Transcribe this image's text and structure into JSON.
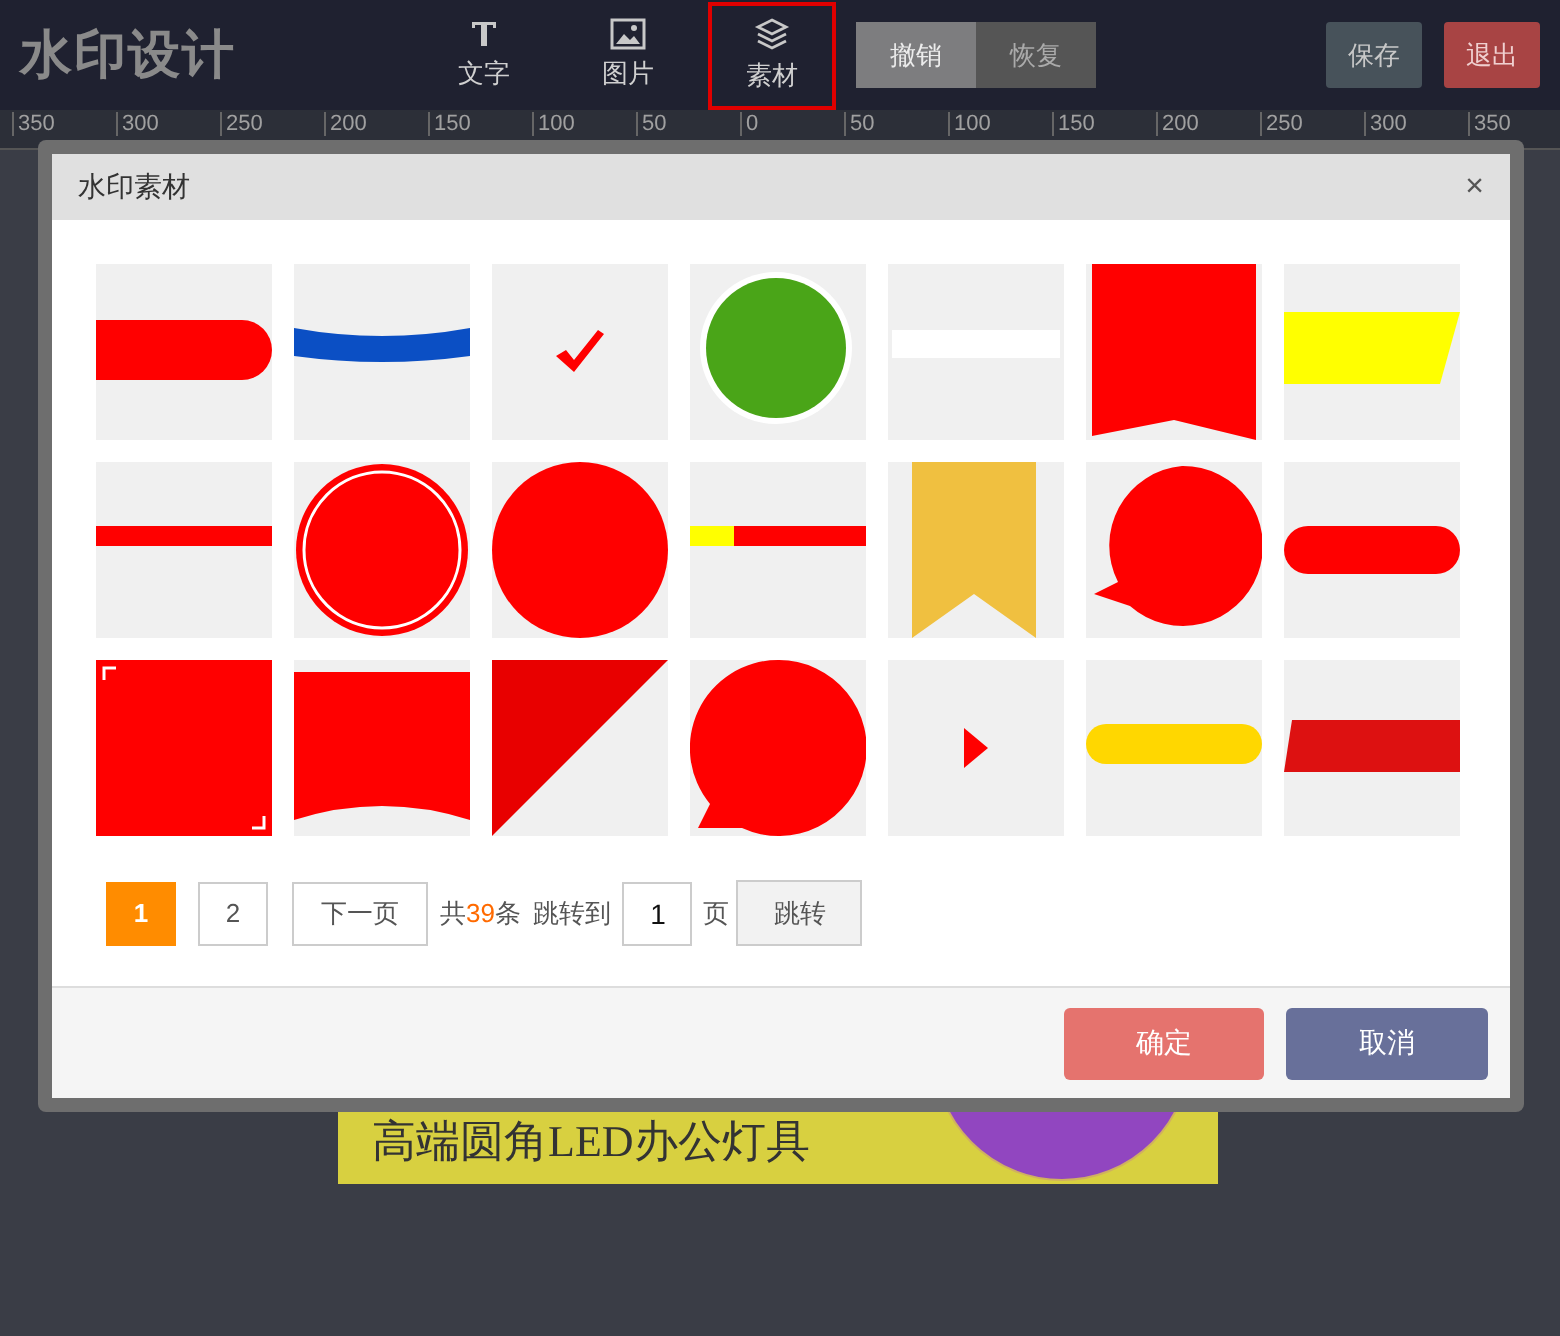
{
  "logo": "水印设计",
  "tools": [
    {
      "label": "文字",
      "kind": "text",
      "selected": false
    },
    {
      "label": "图片",
      "kind": "image",
      "selected": false
    },
    {
      "label": "素材",
      "kind": "layers",
      "selected": true
    }
  ],
  "history_buttons": [
    {
      "label": "撤销",
      "disabled": false
    },
    {
      "label": "恢复",
      "disabled": true
    }
  ],
  "save_button": "保存",
  "exit_button": "退出",
  "ruler": [
    "350",
    "300",
    "250",
    "200",
    "150",
    "100",
    "50",
    "0",
    "50",
    "100",
    "150",
    "200",
    "250",
    "300",
    "350"
  ],
  "banner": {
    "text": "高端圆角LED办公灯具"
  },
  "dialog": {
    "title": "水印素材",
    "close": "×",
    "materials": [
      {
        "kind": "pill-right"
      },
      {
        "kind": "blue-curve"
      },
      {
        "kind": "check"
      },
      {
        "kind": "green-circle"
      },
      {
        "kind": "white-bar"
      },
      {
        "kind": "red-ribbon"
      },
      {
        "kind": "yellow-trapezoid"
      },
      {
        "kind": "thin-bar"
      },
      {
        "kind": "ring-circle"
      },
      {
        "kind": "circle"
      },
      {
        "kind": "yellow-red-bar"
      },
      {
        "kind": "gold-ribbon"
      },
      {
        "kind": "speech-circle"
      },
      {
        "kind": "red-pill"
      },
      {
        "kind": "corner-square"
      },
      {
        "kind": "wave-banner"
      },
      {
        "kind": "corner-fold"
      },
      {
        "kind": "speech-circle-big"
      },
      {
        "kind": "triangle"
      },
      {
        "kind": "yellow-pill"
      },
      {
        "kind": "parallelogram"
      }
    ],
    "pagination": {
      "pages": [
        {
          "label": "1",
          "selected": true
        },
        {
          "label": "2",
          "selected": false
        }
      ],
      "next": "下一页",
      "total_prefix": "共",
      "total": "39",
      "total_suffix": "条",
      "jump_label": "跳转到",
      "jump_value": "1",
      "page_unit": "页",
      "jump_button": "跳转"
    },
    "confirm": "确定",
    "cancel": "取消"
  }
}
